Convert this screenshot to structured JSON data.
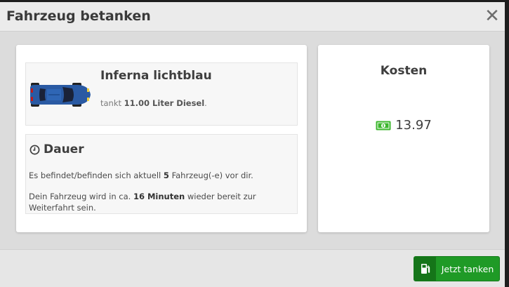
{
  "modal": {
    "title": "Fahrzeug betanken",
    "close_icon": "close-icon"
  },
  "vehicle": {
    "name": "Inferna lichtblau",
    "sub_prefix": "tankt",
    "amount": "11.00 Liter Diesel",
    "sub_suffix": ".",
    "icon": "car-top-view-icon",
    "color": "#2a5aa3"
  },
  "duration": {
    "title": "Dauer",
    "icon": "clock-icon",
    "line1_prefix": "Es befindet/befinden sich aktuell",
    "queue_count": "5",
    "line1_suffix": "Fahrzeug(-e) vor dir.",
    "line2_prefix": "Dein Fahrzeug wird in ca.",
    "time": "16 Minuten",
    "line2_suffix": "wieder bereit zur Weiterfahrt sein."
  },
  "costs": {
    "title": "Kosten",
    "icon": "money-bill-icon",
    "value": "13.97",
    "icon_color": "#3cb72c"
  },
  "footer": {
    "button_label": "Jetzt tanken",
    "button_icon": "fuel-pump-icon",
    "button_color": "#1f9a26"
  }
}
